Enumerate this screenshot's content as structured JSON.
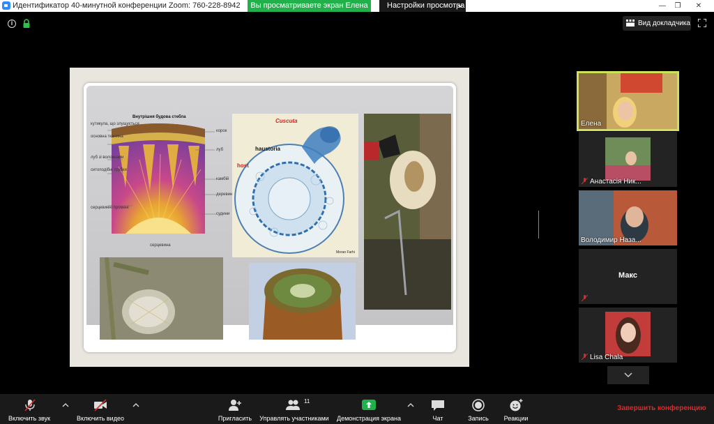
{
  "titlebar": {
    "title": "Идентификатор 40-минутной конференции Zoom: 760-228-8942",
    "share_banner": "Вы просматриваете экран Елена",
    "view_options": "Настройки просмотра",
    "minimize_symbol": "—",
    "restore_symbol": "❐",
    "close_symbol": "✕"
  },
  "top": {
    "info_symbol": "i",
    "speaker_view": "Вид докладчика"
  },
  "slide": {
    "stem_title": "Внутрішня будова стебла",
    "stem_labels_left": [
      "кутикула, що злущується",
      "основна тканина",
      "луб зі волокнами",
      "ситоподібні трубки",
      "серцевинні промені"
    ],
    "stem_labels_right": [
      "корок",
      "луб",
      "камбій",
      "деревина",
      "судини"
    ],
    "stem_bottom_label": "серцевина",
    "cuscuta_label": "Cuscuta",
    "haustoria_label": "haustoria",
    "host_label": "host",
    "credit": "Moran Farhi"
  },
  "participants": [
    {
      "name": "Елена",
      "muted": false,
      "active": true,
      "video": true
    },
    {
      "name": "Анастасія Ник...",
      "muted": true,
      "active": false,
      "video": true
    },
    {
      "name": "Володимир Наза...",
      "muted": false,
      "active": false,
      "video": true
    },
    {
      "name": "Макс",
      "muted": true,
      "active": false,
      "video": false
    },
    {
      "name": "Lisa Chala",
      "muted": true,
      "active": false,
      "video": true
    }
  ],
  "toolbar": {
    "unmute": "Включить звук",
    "start_video": "Включить видео",
    "invite": "Пригласить",
    "manage_participants": "Управлять участниками",
    "participants_count": "11",
    "share_screen": "Демонстрация экрана",
    "chat": "Чат",
    "record": "Запись",
    "reactions": "Реакции",
    "end_meeting": "Завершить конференцию"
  },
  "colors": {
    "share_banner": "#21b14a",
    "active_speaker_border": "#cbe35c",
    "end_meeting": "#e02828",
    "muted_mic": "#e02828"
  }
}
